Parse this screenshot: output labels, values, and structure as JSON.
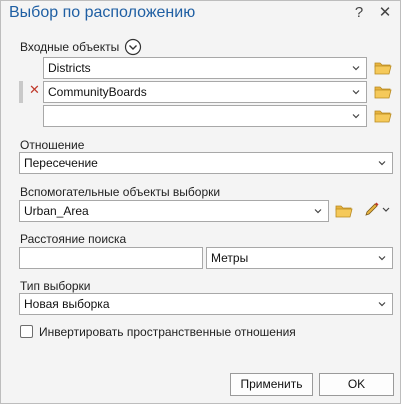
{
  "window": {
    "title": "Выбор по расположению",
    "help_glyph": "?",
    "close_glyph": "✕"
  },
  "input_features": {
    "label": "Входные объекты",
    "rows": [
      "Districts",
      "CommunityBoards",
      ""
    ],
    "remove_glyph": "✕"
  },
  "relationship": {
    "label": "Отношение",
    "value": "Пересечение"
  },
  "selecting_features": {
    "label": "Вспомогательные объекты выборки",
    "value": "Urban_Area"
  },
  "search_distance": {
    "label": "Расстояние поиска",
    "value": "",
    "unit": "Метры"
  },
  "selection_type": {
    "label": "Тип выборки",
    "value": "Новая выборка"
  },
  "invert": {
    "label": "Инвертировать пространственные отношения",
    "checked": false
  },
  "buttons": {
    "apply": "Применить",
    "ok": "OK"
  },
  "icons": {
    "folder": "folder-open-icon",
    "expand": "circle-chevron-down-icon",
    "edit": "pencil-icon",
    "dropdown": "chevron-down-icon"
  },
  "colors": {
    "title": "#1f5fa3",
    "folder": "#e8b440",
    "remove": "#c0392b"
  }
}
